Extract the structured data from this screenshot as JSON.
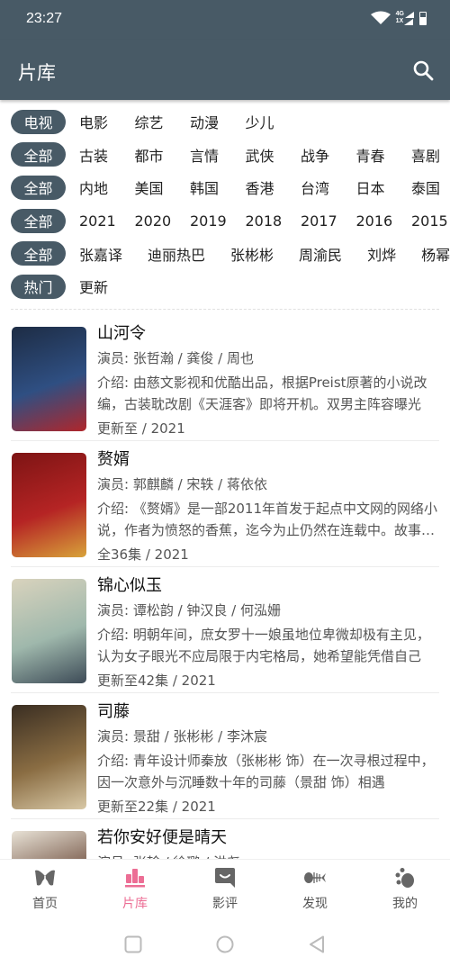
{
  "status_bar": {
    "time": "23:27",
    "network_top": "4G",
    "network_bottom": "1X",
    "icons": [
      "wifi-icon",
      "signal-icon",
      "battery-charging-icon"
    ]
  },
  "app_bar": {
    "title": "片库",
    "search_icon": "search-icon"
  },
  "filters": [
    {
      "selected": "电视",
      "options": [
        "电影",
        "综艺",
        "动漫",
        "少儿"
      ]
    },
    {
      "selected": "全部",
      "options": [
        "古装",
        "都市",
        "言情",
        "武侠",
        "战争",
        "青春",
        "喜剧"
      ]
    },
    {
      "selected": "全部",
      "options": [
        "内地",
        "美国",
        "韩国",
        "香港",
        "台湾",
        "日本",
        "泰国"
      ]
    },
    {
      "selected": "全部",
      "options": [
        "2021",
        "2020",
        "2019",
        "2018",
        "2017",
        "2016",
        "2015"
      ]
    },
    {
      "selected": "全部",
      "options": [
        "张嘉译",
        "迪丽热巴",
        "张彬彬",
        "周渝民",
        "刘烨",
        "杨幂"
      ]
    },
    {
      "selected": "热门",
      "options": [
        "更新"
      ]
    }
  ],
  "shows": [
    {
      "title": "山河令",
      "actors": "演员: 张哲瀚 / 龚俊 / 周也",
      "intro": "介绍: 由慈文影视和优酷出品，根据Preist原著的小说改编，古装耽改剧《天涯客》即将开机。双男主阵容曝光",
      "meta": "更新至 / 2021",
      "poster_colors": [
        "#1d2c44",
        "#2f4f82",
        "#b0262b"
      ]
    },
    {
      "title": "赘婿",
      "actors": "演员: 郭麒麟 / 宋轶 / 蒋依依",
      "intro": "介绍: 《赘婿》是一部2011年首发于起点中文网的网络小说，作者为愤怒的香蕉，迄今为止仍然在连载中。故事讲述",
      "meta": "全36集 / 2021",
      "poster_colors": [
        "#7d1414",
        "#b52424",
        "#d8a33a"
      ]
    },
    {
      "title": "锦心似玉",
      "actors": "演员: 谭松韵 / 钟汉良 / 何泓姗",
      "intro": "介绍: 明朝年间，庶女罗十一娘虽地位卑微却极有主见，认为女子眼光不应局限于内宅格局，她希望能凭借自己",
      "meta": "更新至42集 / 2021",
      "poster_colors": [
        "#d9d3bd",
        "#9fb8ac",
        "#3d4b57"
      ]
    },
    {
      "title": "司藤",
      "actors": "演员: 景甜 /  张彬彬 / 李沐宸",
      "intro": "介绍: 青年设计师秦放（张彬彬 饰）在一次寻根过程中，因一次意外与沉睡数十年的司藤（景甜 饰）相遇",
      "meta": "更新至22集 / 2021",
      "poster_colors": [
        "#3a2e22",
        "#8a6d43",
        "#d8c8a6"
      ]
    },
    {
      "title": "若你安好便是晴天",
      "actors": "演员: 张翰 / 徐璐 / 洪尧",
      "intro": "",
      "meta": "",
      "poster_colors": [
        "#e8e2d6",
        "#6b4a3a",
        "#c9bfae"
      ]
    }
  ],
  "tab_bar": {
    "active_color": "#ec6e95",
    "tabs": [
      {
        "label": "首页",
        "icon": "home-butterfly-icon",
        "active": false
      },
      {
        "label": "片库",
        "icon": "library-icon",
        "active": true
      },
      {
        "label": "影评",
        "icon": "review-chat-icon",
        "active": false
      },
      {
        "label": "发现",
        "icon": "discover-fishbone-icon",
        "active": false
      },
      {
        "label": "我的",
        "icon": "profile-paw-icon",
        "active": false
      }
    ]
  },
  "system_nav": [
    "recents-icon",
    "home-icon",
    "back-icon"
  ]
}
